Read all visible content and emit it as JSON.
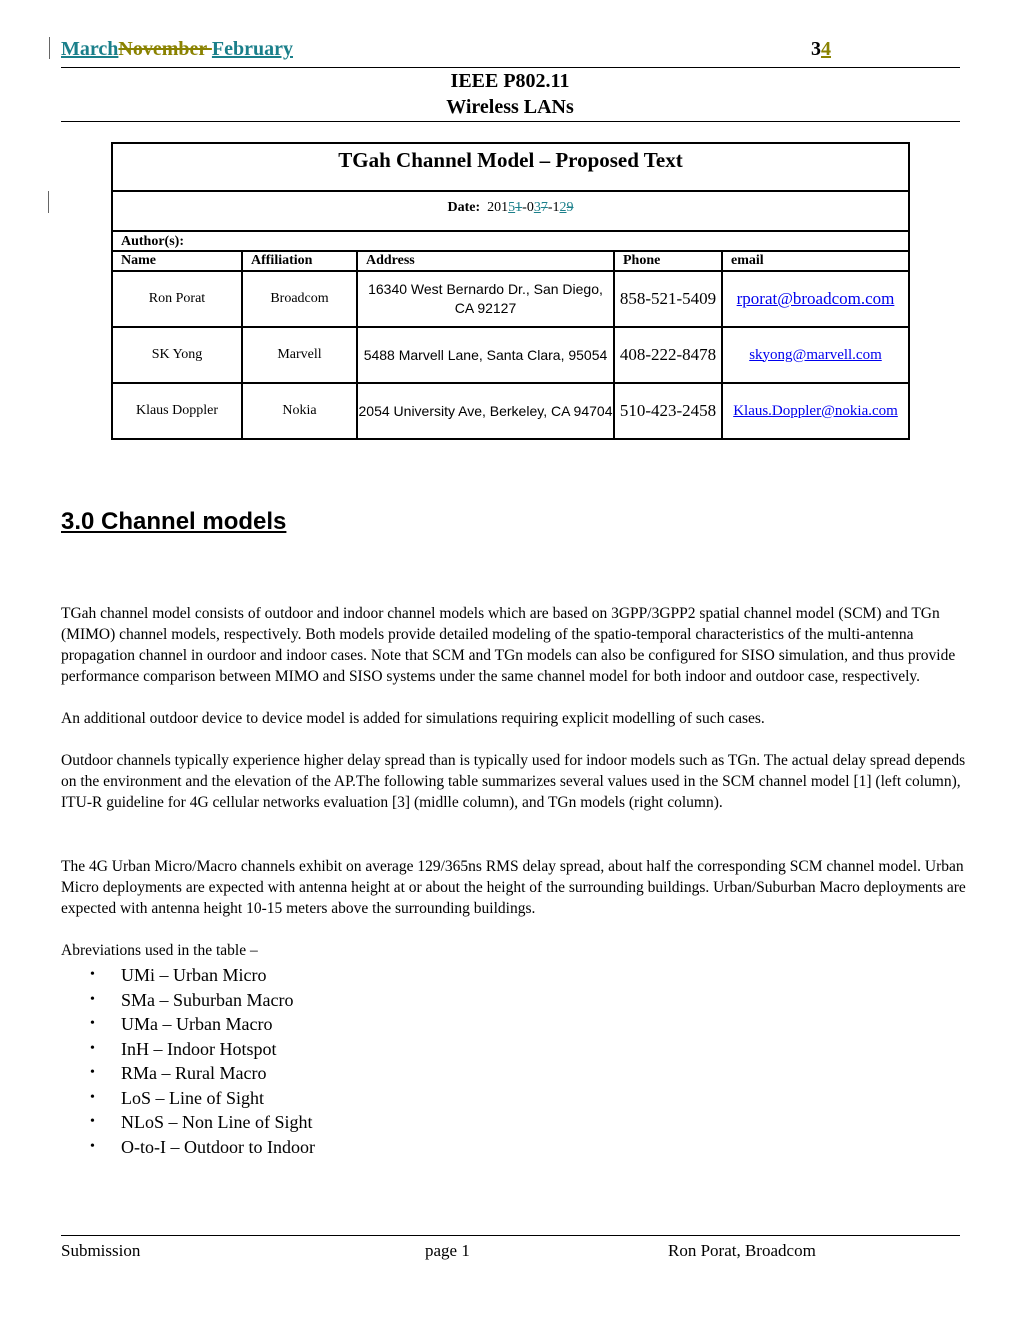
{
  "header": {
    "date_segments": [
      {
        "text": "March",
        "style": "ins-teal"
      },
      {
        "text": "November ",
        "style": "del-olive"
      },
      {
        "text": "February",
        "style": "ins-teal"
      },
      {
        "text": " ",
        "style": "ins-olive"
      }
    ],
    "doc_segments": [
      {
        "text": " ",
        "style": "ins-teal"
      },
      {
        "text": "3",
        "style": "plain"
      },
      {
        "text": "4",
        "style": "ins-olive"
      }
    ],
    "org": "IEEE P802.11",
    "group": "Wireless LANs"
  },
  "cover": {
    "title": "TGah Channel Model – Proposed Text",
    "date_label": "Date:",
    "date_segments": [
      {
        "text": "201",
        "style": "plain"
      },
      {
        "text": "5",
        "style": "ins-teal"
      },
      {
        "text": "1",
        "style": "del-teal"
      },
      {
        "text": "-0",
        "style": "plain"
      },
      {
        "text": "3",
        "style": "ins-teal"
      },
      {
        "text": "7",
        "style": "del-teal"
      },
      {
        "text": "-1",
        "style": "plain"
      },
      {
        "text": "2",
        "style": "ins-teal"
      },
      {
        "text": "9",
        "style": "del-teal"
      }
    ],
    "authors_label": "Author(s):",
    "columns": [
      "Name",
      "Affiliation",
      "Address",
      "Phone",
      "email"
    ],
    "authors": [
      {
        "name": "Ron Porat",
        "affiliation": "Broadcom",
        "address": "16340 West Bernardo Dr., San Diego, CA 92127",
        "phone": "858-521-5409",
        "email": "rporat@broadcom.com"
      },
      {
        "name": "SK Yong",
        "affiliation": "Marvell",
        "address": "5488 Marvell Lane, Santa Clara, 95054",
        "phone": "408-222-8478",
        "email": "skyong@marvell.com"
      },
      {
        "name": "Klaus Doppler",
        "affiliation": "Nokia",
        "address": "2054 University Ave, Berkeley, CA 94704",
        "phone": "510-423-2458",
        "email": "Klaus.Doppler@nokia.com"
      }
    ]
  },
  "section": {
    "heading": "3.0 Channel models",
    "paragraphs": [
      "TGah channel model consists of outdoor and indoor channel models which are based on 3GPP/3GPP2 spatial channel model (SCM) and TGn (MIMO) channel models, respectively.  Both models provide detailed modeling of the spatio-temporal characteristics of the multi-antenna propagation channel in ourdoor and indoor cases. Note that SCM and TGn models can also be configured for SISO simulation, and thus provide performance comparison between MIMO and SISO systems under the same channel model for both indoor and outdoor case, respectively.",
      "An additional outdoor device to device model is added for simulations requiring explicit modelling of such cases.",
      "Outdoor channels typically experience higher delay spread than is typically used for indoor models such as TGn.  The actual delay spread depends on the environment and the elevation of the AP.The following table summarizes several values used in the SCM channel model [1] (left column), ITU-R guideline for 4G cellular networks evaluation [3] (midlle column), and TGn models (right column).",
      "The 4G Urban Micro/Macro channels exhibit on average 129/365ns RMS delay spread, about half the corresponding SCM channel model. Urban Micro deployments are expected with antenna height at or about the height of the surrounding buildings. Urban/Suburban Macro deployments are expected with antenna height 10-15 meters above the surrounding buildings.",
      "Abreviations used in the table –"
    ],
    "abbreviations": [
      "UMi – Urban Micro",
      "SMa – Suburban Macro",
      "UMa – Urban Macro",
      "InH – Indoor Hotspot",
      "RMa – Rural Macro",
      "LoS – Line of Sight",
      "NLoS – Non Line of Sight",
      "O-to-I – Outdoor to Indoor"
    ],
    "bullet_glyph": "•"
  },
  "footer": {
    "left": "Submission",
    "center": "page 1",
    "right": "Ron Porat, Broadcom"
  }
}
